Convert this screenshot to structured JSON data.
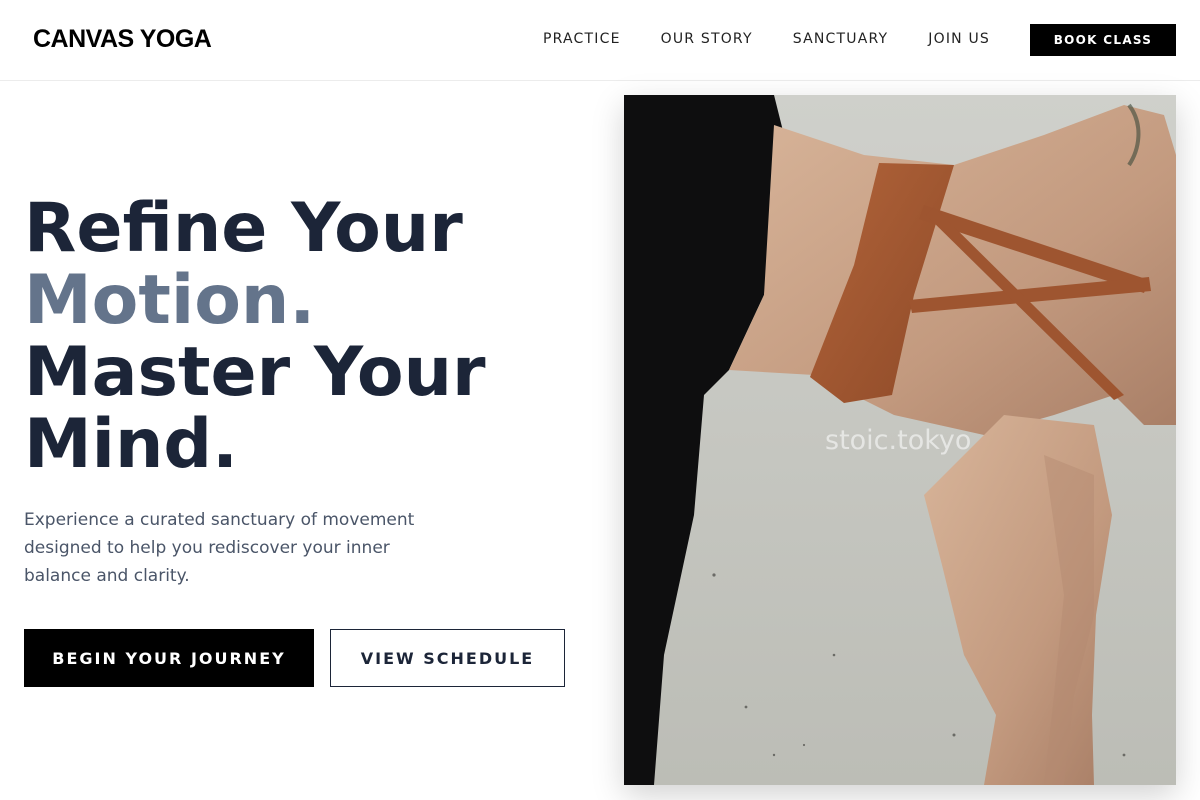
{
  "header": {
    "logo": "CANVAS YOGA",
    "nav": [
      "PRACTICE",
      "OUR STORY",
      "SANCTUARY",
      "JOIN US"
    ],
    "cta": "BOOK CLASS"
  },
  "hero": {
    "heading_line1": "Refine Your",
    "heading_line2": "Motion.",
    "heading_line3": "Master Your",
    "heading_line4": "Mind.",
    "subtitle": "Experience a curated sanctuary of movement designed to help you rediscover your inner balance and clarity.",
    "primary_cta": "BEGIN YOUR JOURNEY",
    "secondary_cta": "VIEW SCHEDULE",
    "image_watermark": "stoic.tokyo"
  },
  "colors": {
    "heading": "#1c2538",
    "accent": "#64748b",
    "body_text": "#4a5568",
    "button_bg": "#000000"
  }
}
